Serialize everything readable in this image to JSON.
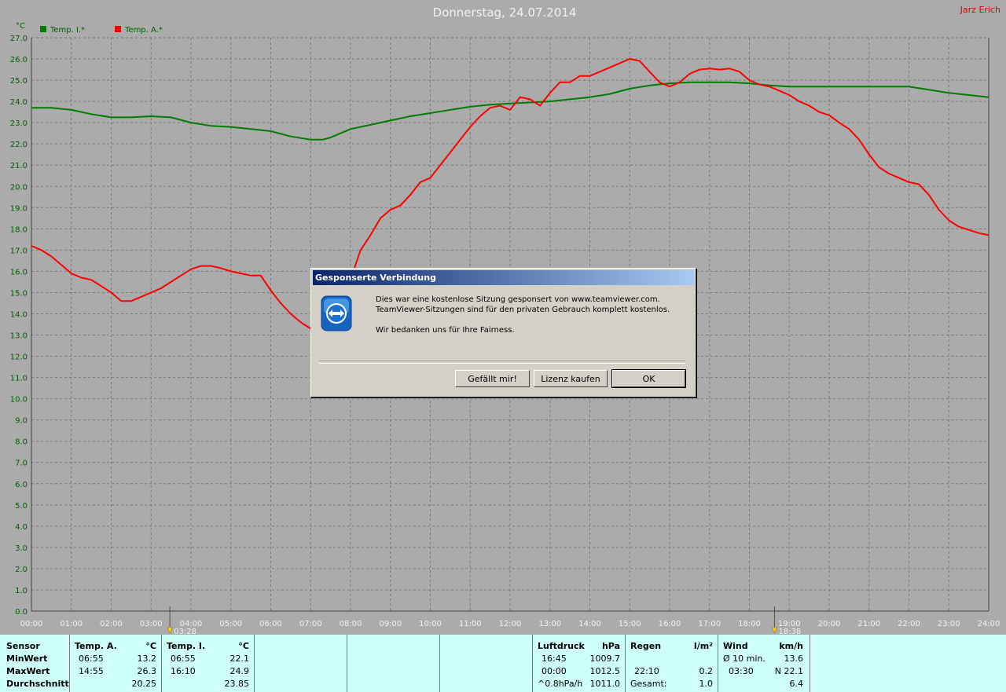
{
  "header": {
    "title": "Donnerstag, 24.07.2014",
    "author": "Jarz Erich"
  },
  "chart_data": {
    "type": "line",
    "ylabel": "°C",
    "ylim": [
      0,
      27
    ],
    "yticks": [
      "0.0",
      "1.0",
      "2.0",
      "3.0",
      "4.0",
      "5.0",
      "6.0",
      "7.0",
      "8.0",
      "9.0",
      "10.0",
      "11.0",
      "12.0",
      "13.0",
      "14.0",
      "15.0",
      "16.0",
      "17.0",
      "18.0",
      "19.0",
      "20.0",
      "21.0",
      "22.0",
      "23.0",
      "24.0",
      "25.0",
      "26.0",
      "27.0"
    ],
    "xlim": [
      0,
      24
    ],
    "xticks": [
      "00:00",
      "01:00",
      "02:00",
      "03:00",
      "04:00",
      "05:00",
      "06:00",
      "07:00",
      "08:00",
      "09:00",
      "10:00",
      "11:00",
      "12:00",
      "13:00",
      "14:00",
      "15:00",
      "16:00",
      "17:00",
      "18:00",
      "19:00",
      "20:00",
      "21:00",
      "22:00",
      "23:00",
      "24:00"
    ],
    "grid": true,
    "legend_position": "top-left",
    "markers": [
      {
        "x": 3.47,
        "label": "03:28",
        "name": "sunrise"
      },
      {
        "x": 18.63,
        "label": "18:38",
        "name": "sunset"
      }
    ],
    "series": [
      {
        "name": "Temp. I.*",
        "color": "#007c00",
        "x": [
          0,
          0.5,
          1,
          1.5,
          2,
          2.5,
          3,
          3.5,
          4,
          4.5,
          5,
          5.5,
          6,
          6.5,
          7,
          7.3,
          7.5,
          8,
          8.5,
          9,
          9.5,
          10,
          10.5,
          11,
          11.5,
          12,
          12.5,
          13,
          13.5,
          14,
          14.5,
          15,
          15.5,
          16,
          16.5,
          17,
          17.5,
          18,
          18.5,
          19,
          19.5,
          20,
          20.5,
          21,
          21.5,
          22,
          22.5,
          23,
          23.5,
          24
        ],
        "values": [
          23.7,
          23.7,
          23.6,
          23.4,
          23.25,
          23.25,
          23.3,
          23.25,
          23.0,
          22.85,
          22.8,
          22.7,
          22.6,
          22.35,
          22.2,
          22.2,
          22.3,
          22.7,
          22.9,
          23.1,
          23.3,
          23.45,
          23.6,
          23.75,
          23.85,
          23.9,
          23.95,
          24.0,
          24.1,
          24.2,
          24.35,
          24.6,
          24.75,
          24.85,
          24.9,
          24.9,
          24.9,
          24.85,
          24.75,
          24.7,
          24.7,
          24.7,
          24.7,
          24.7,
          24.7,
          24.7,
          24.55,
          24.4,
          24.3,
          24.2
        ]
      },
      {
        "name": "Temp. A.*",
        "color": "#ff0000",
        "x": [
          0,
          0.25,
          0.5,
          0.75,
          1,
          1.25,
          1.5,
          1.75,
          2,
          2.25,
          2.5,
          2.75,
          3,
          3.25,
          3.5,
          3.75,
          4,
          4.25,
          4.5,
          4.75,
          5,
          5.25,
          5.5,
          5.75,
          6,
          6.25,
          6.5,
          6.75,
          7,
          7.25,
          7.5,
          7.75,
          8,
          8.25,
          8.5,
          8.75,
          9,
          9.25,
          9.5,
          9.75,
          10,
          10.25,
          10.5,
          10.75,
          11,
          11.25,
          11.5,
          11.75,
          12,
          12.25,
          12.5,
          12.75,
          13,
          13.25,
          13.5,
          13.75,
          14,
          14.25,
          14.5,
          14.75,
          15,
          15.25,
          15.5,
          15.75,
          16,
          16.25,
          16.5,
          16.75,
          17,
          17.25,
          17.5,
          17.75,
          18,
          18.25,
          18.5,
          18.75,
          19,
          19.25,
          19.5,
          19.75,
          20,
          20.25,
          20.5,
          20.75,
          21,
          21.25,
          21.5,
          21.75,
          22,
          22.25,
          22.5,
          22.75,
          23,
          23.25,
          23.5,
          23.75,
          24
        ],
        "values": [
          17.2,
          17.0,
          16.7,
          16.3,
          15.9,
          15.7,
          15.6,
          15.3,
          15.0,
          14.6,
          14.6,
          14.8,
          15.0,
          15.2,
          15.5,
          15.8,
          16.1,
          16.25,
          16.25,
          16.15,
          16.0,
          15.9,
          15.8,
          15.8,
          15.1,
          14.5,
          14.0,
          13.6,
          13.3,
          13.4,
          13.8,
          14.5,
          15.6,
          17.0,
          17.7,
          18.5,
          18.9,
          19.1,
          19.6,
          20.2,
          20.4,
          21.0,
          21.6,
          22.2,
          22.8,
          23.3,
          23.7,
          23.8,
          23.6,
          24.2,
          24.1,
          23.8,
          24.4,
          24.9,
          24.9,
          25.2,
          25.2,
          25.4,
          25.6,
          25.8,
          26.0,
          25.9,
          25.4,
          24.9,
          24.7,
          24.9,
          25.3,
          25.5,
          25.55,
          25.5,
          25.55,
          25.4,
          25.0,
          24.8,
          24.7,
          24.5,
          24.3,
          24.0,
          23.8,
          23.5,
          23.35,
          23.0,
          22.7,
          22.2,
          21.5,
          20.9,
          20.6,
          20.4,
          20.2,
          20.1,
          19.6,
          18.9,
          18.4,
          18.1,
          17.95,
          17.8,
          17.7
        ]
      }
    ]
  },
  "stats": {
    "sensor": {
      "header": "Sensor",
      "rows": [
        "MinWert",
        "MaxWert",
        "Durchschnitt"
      ]
    },
    "temp_a": {
      "header": "Temp. A.",
      "unit": "°C",
      "min_time": "06:55",
      "min_val": "13.2",
      "max_time": "14:55",
      "max_val": "26.3",
      "avg_val": "20.25"
    },
    "temp_i": {
      "header": "Temp. I.",
      "unit": "°C",
      "min_time": "06:55",
      "min_val": "22.1",
      "max_time": "16:10",
      "max_val": "24.9",
      "avg_val": "23.85"
    },
    "pressure": {
      "header": "Luftdruck",
      "unit": "hPa",
      "r1_time": "16:45",
      "r1_val": "1009.7",
      "r2_time": "00:00",
      "r2_val": "1012.5",
      "r3_time": "^0.8hPa/h",
      "r3_val": "1011.0"
    },
    "rain": {
      "header": "Regen",
      "unit": "l/m²",
      "r2_time": "22:10",
      "r2_val": "0.2",
      "r3_label": "Gesamt:",
      "r3_val": "1.0"
    },
    "wind": {
      "header": "Wind",
      "unit": "km/h",
      "r1_label": "Ø 10 min.",
      "r1_val": "13.6",
      "r2_time": "03:30",
      "r2_val": "N 22.1",
      "r3_val": "6.4"
    }
  },
  "dialog": {
    "title": "Gesponserte Verbindung",
    "icon": "teamviewer-icon",
    "line1": "Dies war eine kostenlose Sitzung gesponsert von www.teamviewer.com.",
    "line2": "TeamViewer-Sitzungen sind für den privaten Gebrauch komplett kostenlos.",
    "line3": "Wir bedanken uns für Ihre Fairness.",
    "btn_like": "Gefällt mir!",
    "btn_license": "Lizenz kaufen",
    "btn_ok": "OK"
  }
}
